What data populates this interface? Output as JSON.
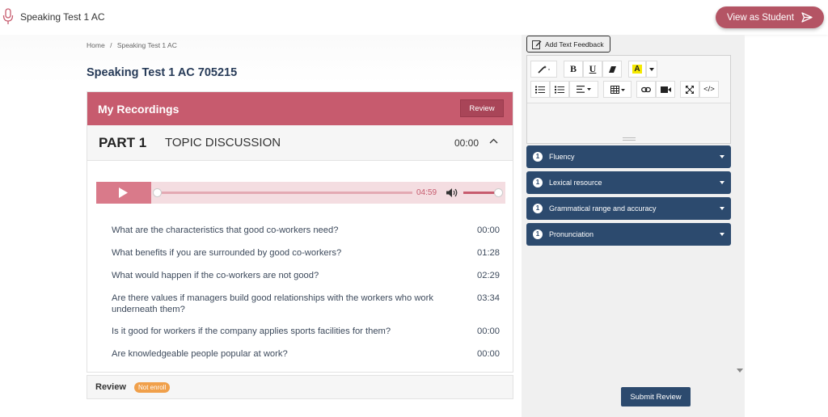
{
  "topbar": {
    "title": "Speaking Test 1 AC",
    "view_student": "View as Student"
  },
  "breadcrumb": {
    "home": "Home",
    "separator": "/",
    "current": "Speaking Test 1 AC"
  },
  "page_title": "Speaking Test 1 AC 705215",
  "recordings": {
    "title": "My Recordings",
    "review_label": "Review",
    "part": {
      "number": "PART 1",
      "topic": "TOPIC DISCUSSION",
      "time": "00:00"
    },
    "player": {
      "time": "04:59",
      "progress": 0,
      "volume": 1
    },
    "questions": [
      {
        "text": "What are the characteristics that good co-workers need?",
        "time": "00:00"
      },
      {
        "text": "What benefits if you are surrounded by good co-workers?",
        "time": "01:28"
      },
      {
        "text": "What would happen if the co-workers are not good?",
        "time": "02:29"
      },
      {
        "text": "Are there values if managers build good relationships with the workers who work underneath them?",
        "time": "03:34"
      },
      {
        "text": "Is it good for workers if the company applies sports facilities for them?",
        "time": "00:00"
      },
      {
        "text": "Are knowledgeable people popular at work?",
        "time": "00:00"
      }
    ]
  },
  "review_bar": {
    "label": "Review",
    "badge": "Not enroll"
  },
  "feedback": {
    "add_text_label": "Add Text Feedback",
    "toolbar": {
      "bold": "B",
      "underline": "U",
      "highlight": "A",
      "code": "</>"
    }
  },
  "criteria": [
    {
      "num": "1",
      "label": "Fluency"
    },
    {
      "num": "1",
      "label": "Lexical resource"
    },
    {
      "num": "1",
      "label": "Grammatical range and accuracy"
    },
    {
      "num": "1",
      "label": "Pronunciation"
    }
  ],
  "submit_label": "Submit Review",
  "colors": {
    "accent": "#c75b6e",
    "navy": "#2c4a6e",
    "badge": "#f0a04b"
  }
}
